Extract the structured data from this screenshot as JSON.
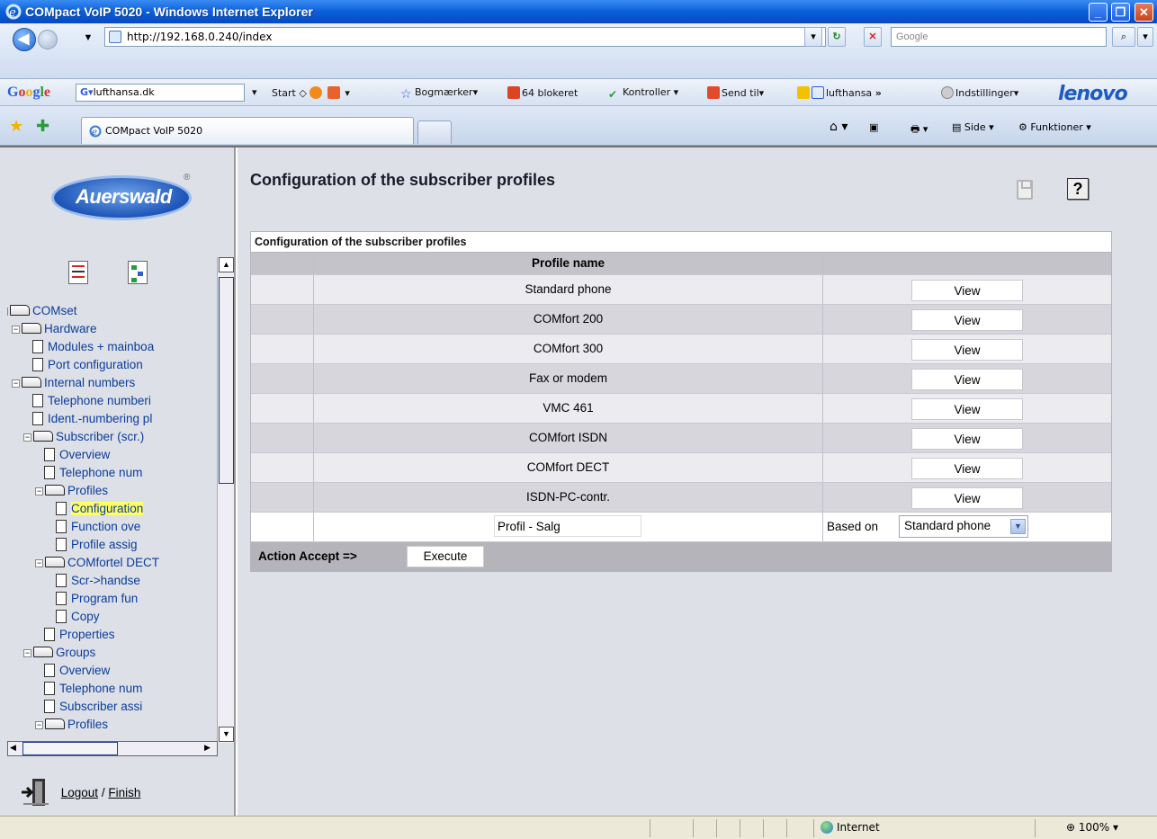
{
  "window": {
    "title": "COMpact VoIP 5020 - Windows Internet Explorer",
    "url": "http://192.168.0.240/index",
    "search_placeholder": "Google"
  },
  "google_toolbar": {
    "logo": "Google",
    "search_value": "lufthansa.dk",
    "items": [
      "Start",
      "Bogmærker",
      "64 blokeret",
      "Kontroller",
      "Send til",
      "lufthansa",
      "Indstillinger"
    ],
    "brand": "lenovo",
    "more": "»"
  },
  "tabs": {
    "active_label": "COMpact VoIP 5020",
    "commands": [
      "Side",
      "Funktioner"
    ]
  },
  "sidebar": {
    "logo_text": "Auerswald",
    "logo_reg": "®",
    "tree": [
      {
        "label": "COMset",
        "level": 0,
        "type": "folder"
      },
      {
        "label": "Hardware",
        "level": 1,
        "type": "folder"
      },
      {
        "label": "Modules + mainboa",
        "level": 2,
        "type": "doc"
      },
      {
        "label": "Port configuration",
        "level": 2,
        "type": "doc"
      },
      {
        "label": "Internal numbers",
        "level": 1,
        "type": "folder"
      },
      {
        "label": "Telephone numberi",
        "level": 2,
        "type": "doc"
      },
      {
        "label": "Ident.-numbering pl",
        "level": 2,
        "type": "doc"
      },
      {
        "label": "Subscriber (scr.)",
        "level": 2,
        "type": "folder"
      },
      {
        "label": "Overview",
        "level": 3,
        "type": "doc"
      },
      {
        "label": "Telephone num",
        "level": 3,
        "type": "doc"
      },
      {
        "label": "Profiles",
        "level": 3,
        "type": "folder"
      },
      {
        "label": "Configuration",
        "level": 4,
        "type": "doc",
        "selected": true
      },
      {
        "label": "Function ove",
        "level": 4,
        "type": "doc"
      },
      {
        "label": "Profile assig",
        "level": 4,
        "type": "doc"
      },
      {
        "label": "COMfortel DECT",
        "level": 3,
        "type": "folder"
      },
      {
        "label": "Scr->handse",
        "level": 4,
        "type": "doc"
      },
      {
        "label": "Program fun",
        "level": 4,
        "type": "doc"
      },
      {
        "label": "Copy",
        "level": 4,
        "type": "doc"
      },
      {
        "label": "Properties",
        "level": 3,
        "type": "doc"
      },
      {
        "label": "Groups",
        "level": 2,
        "type": "folder"
      },
      {
        "label": "Overview",
        "level": 3,
        "type": "doc"
      },
      {
        "label": "Telephone num",
        "level": 3,
        "type": "doc"
      },
      {
        "label": "Subscriber assi",
        "level": 3,
        "type": "doc"
      },
      {
        "label": "Profiles",
        "level": 3,
        "type": "folder"
      }
    ],
    "logout": "Logout",
    "sep": " / ",
    "finish": "Finish"
  },
  "main": {
    "page_title": "Configuration of the subscriber profiles",
    "help_label": "?",
    "table": {
      "caption": "Configuration of the subscriber profiles",
      "col_header": "Profile name",
      "rows": [
        {
          "name": "Standard phone",
          "button": "View"
        },
        {
          "name": "COMfort 200",
          "button": "View"
        },
        {
          "name": "COMfort 300",
          "button": "View"
        },
        {
          "name": "Fax or modem",
          "button": "View"
        },
        {
          "name": "VMC 461",
          "button": "View"
        },
        {
          "name": "COMfort ISDN",
          "button": "View"
        },
        {
          "name": "COMfort DECT",
          "button": "View"
        },
        {
          "name": "ISDN-PC-contr.",
          "button": "View"
        }
      ],
      "new_profile_value": "Profil - Salg",
      "based_on_label": "Based on",
      "based_on_value": "Standard phone",
      "action_label": "Action  Accept  =>",
      "execute_label": "Execute"
    }
  },
  "statusbar": {
    "zone": "Internet",
    "zoom": "100%"
  }
}
